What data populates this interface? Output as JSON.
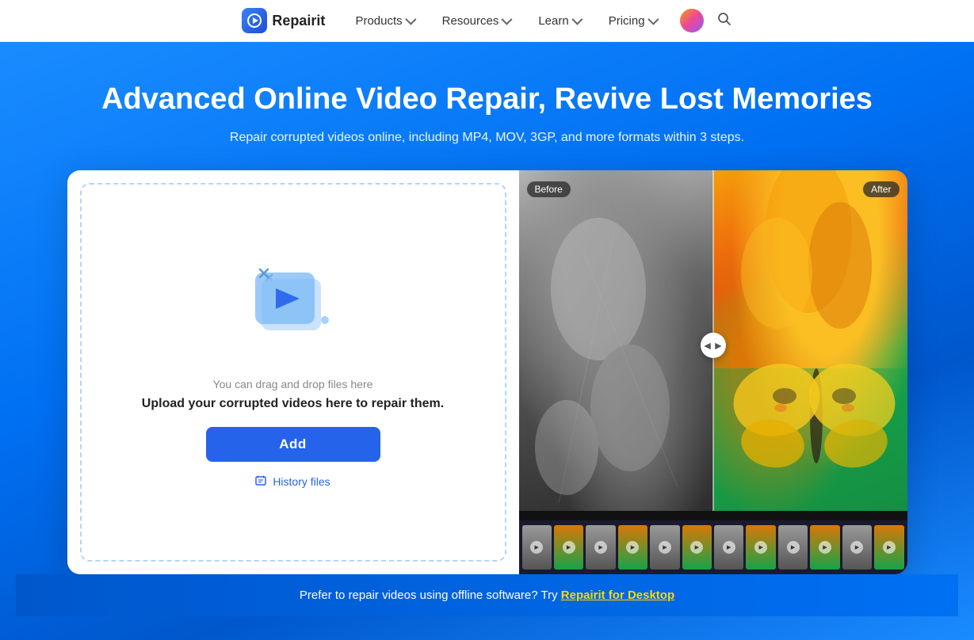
{
  "navbar": {
    "logo_text": "Repairit",
    "items": [
      {
        "label": "Products",
        "has_chevron": true
      },
      {
        "label": "Resources",
        "has_chevron": true
      },
      {
        "label": "Learn",
        "has_chevron": true
      },
      {
        "label": "Pricing",
        "has_chevron": true
      }
    ]
  },
  "hero": {
    "title": "Advanced Online Video Repair, Revive Lost Memories",
    "subtitle": "Repair corrupted videos online, including MP4, MOV, 3GP, and more formats within 3 steps."
  },
  "upload": {
    "drag_text": "You can drag and drop files here",
    "main_text": "Upload your corrupted videos here to repair them.",
    "add_button": "Add",
    "history_label": "History files"
  },
  "preview": {
    "before_label": "Before",
    "after_label": "After"
  },
  "footer": {
    "text": "Prefer to repair videos using offline software? Try ",
    "link_text": "Repairit for Desktop"
  }
}
